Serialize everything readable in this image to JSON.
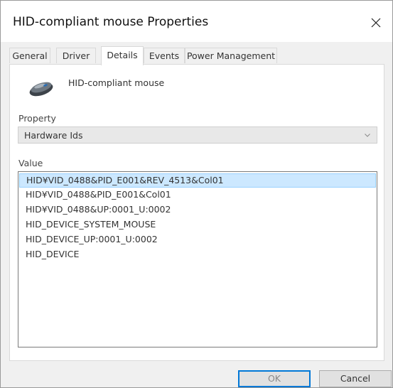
{
  "window": {
    "title": "HID-compliant mouse Properties"
  },
  "tabs": [
    {
      "label": "General",
      "active": false
    },
    {
      "label": "Driver",
      "active": false
    },
    {
      "label": "Details",
      "active": true
    },
    {
      "label": "Events",
      "active": false
    },
    {
      "label": "Power Management",
      "active": false
    }
  ],
  "device": {
    "name": "HID-compliant mouse",
    "icon": "mouse-icon"
  },
  "property": {
    "label": "Property",
    "selected": "Hardware Ids"
  },
  "value": {
    "label": "Value",
    "items": [
      "HID¥VID_0488&PID_E001&REV_4513&Col01",
      "HID¥VID_0488&PID_E001&Col01",
      "HID¥VID_0488&UP:0001_U:0002",
      "HID_DEVICE_SYSTEM_MOUSE",
      "HID_DEVICE_UP:0001_U:0002",
      "HID_DEVICE"
    ],
    "selected_index": 0
  },
  "buttons": {
    "ok_label": "OK",
    "cancel_label": "Cancel"
  },
  "colors": {
    "selection_bg": "#cce8ff",
    "selection_border": "#99d1ff",
    "focus_border": "#0078d7"
  }
}
